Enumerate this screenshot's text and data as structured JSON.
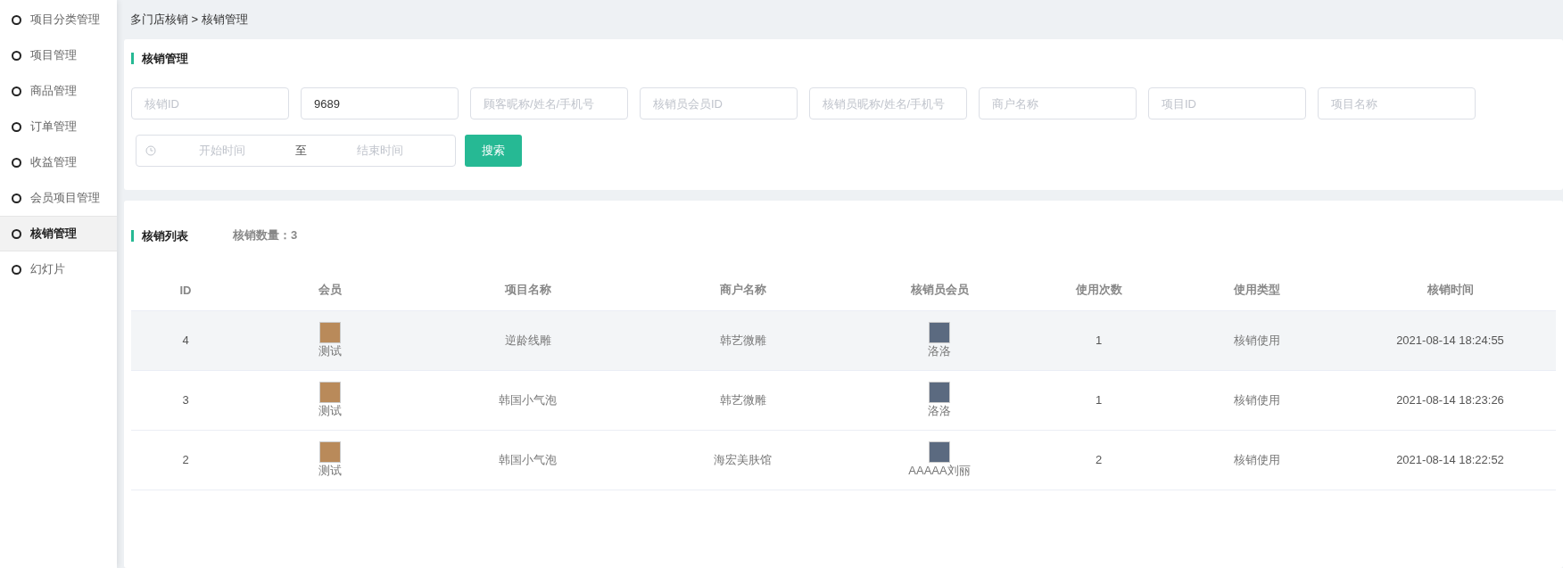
{
  "sidebar": {
    "items": [
      {
        "label": "项目分类管理",
        "selected": false
      },
      {
        "label": "项目管理",
        "selected": false
      },
      {
        "label": "商品管理",
        "selected": false
      },
      {
        "label": "订单管理",
        "selected": false
      },
      {
        "label": "收益管理",
        "selected": false
      },
      {
        "label": "会员项目管理",
        "selected": false
      },
      {
        "label": "核销管理",
        "selected": true
      },
      {
        "label": "幻灯片",
        "selected": false
      }
    ]
  },
  "breadcrumb": "多门店核销 > 核销管理",
  "filter_panel": {
    "title": "核销管理",
    "fields": [
      {
        "placeholder": "核销ID"
      },
      {
        "value": "9689"
      },
      {
        "placeholder": "顾客昵称/姓名/手机号"
      },
      {
        "placeholder": "核销员会员ID"
      },
      {
        "placeholder": "核销员昵称/姓名/手机号"
      },
      {
        "placeholder": "商户名称"
      },
      {
        "placeholder": "项目ID"
      },
      {
        "placeholder": "项目名称"
      }
    ],
    "date_range": {
      "start_placeholder": "开始时间",
      "separator": "至",
      "end_placeholder": "结束时间"
    },
    "search_button": "搜索"
  },
  "list_panel": {
    "title": "核销列表",
    "count": "核销数量：3",
    "table": {
      "columns": [
        "ID",
        "会员",
        "项目名称",
        "商户名称",
        "核销员会员",
        "使用次数",
        "使用类型",
        "核销时间"
      ],
      "rows": [
        {
          "highlighted": true,
          "id": "4",
          "member": "测试",
          "project": "逆龄线雕",
          "merchant": "韩艺微雕",
          "staff": "洛洛",
          "uses": "1",
          "use_type": "核销使用",
          "time": "2021-08-14 18:24:55"
        },
        {
          "highlighted": false,
          "id": "3",
          "member": "测试",
          "project": "韩国小气泡",
          "merchant": "韩艺微雕",
          "staff": "洛洛",
          "uses": "1",
          "use_type": "核销使用",
          "time": "2021-08-14 18:23:26"
        },
        {
          "highlighted": false,
          "id": "2",
          "member": "测试",
          "project": "韩国小气泡",
          "merchant": "海宏美肤馆",
          "staff": "AAAAA刘丽",
          "uses": "2",
          "use_type": "核销使用",
          "time": "2021-08-14 18:22:52"
        }
      ]
    }
  }
}
